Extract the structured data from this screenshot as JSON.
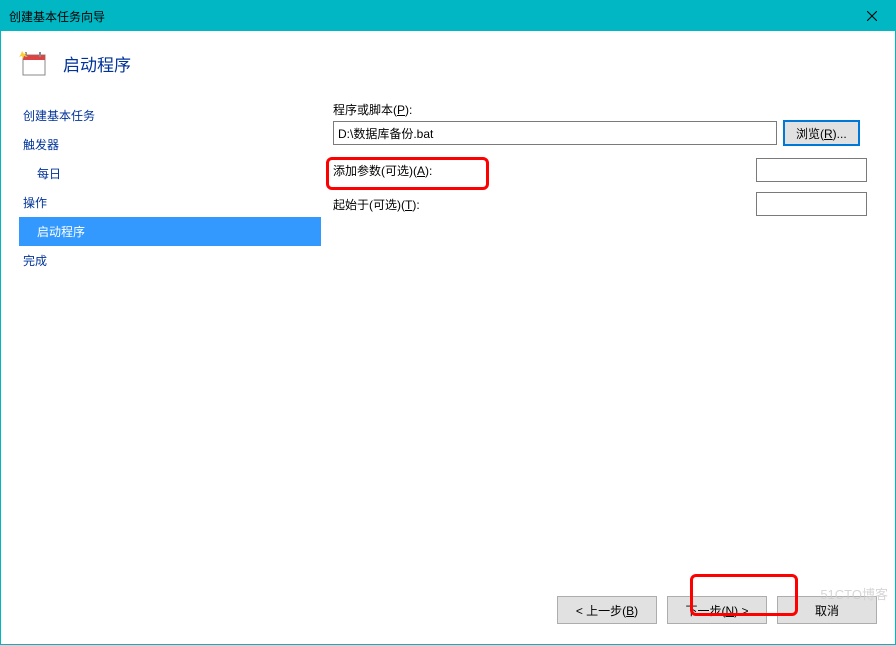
{
  "titlebar": {
    "title": "创建基本任务向导"
  },
  "header": {
    "title": "启动程序"
  },
  "sidebar": {
    "items": [
      {
        "label": "创建基本任务",
        "selected": false,
        "child": false
      },
      {
        "label": "触发器",
        "selected": false,
        "child": false
      },
      {
        "label": "每日",
        "selected": false,
        "child": true
      },
      {
        "label": "操作",
        "selected": false,
        "child": false
      },
      {
        "label": "启动程序",
        "selected": true,
        "child": true
      },
      {
        "label": "完成",
        "selected": false,
        "child": false
      }
    ]
  },
  "form": {
    "program_label_prefix": "程序或脚本(",
    "program_label_hotkey": "P",
    "program_label_suffix": "):",
    "program_value": "D:\\数据库备份.bat",
    "browse_prefix": "浏览(",
    "browse_hotkey": "R",
    "browse_suffix": ")...",
    "args_label_prefix": "添加参数(可选)(",
    "args_hotkey": "A",
    "args_label_suffix": "):",
    "args_value": "",
    "startin_label_prefix": "起始于(可选)(",
    "startin_hotkey": "T",
    "startin_label_suffix": "):",
    "startin_value": ""
  },
  "footer": {
    "back_prefix": "< 上一步(",
    "back_hotkey": "B",
    "back_suffix": ")",
    "next_prefix": "下一步(",
    "next_hotkey": "N",
    "next_suffix": ") >",
    "cancel": "取消"
  },
  "watermark": "51CTO博客"
}
